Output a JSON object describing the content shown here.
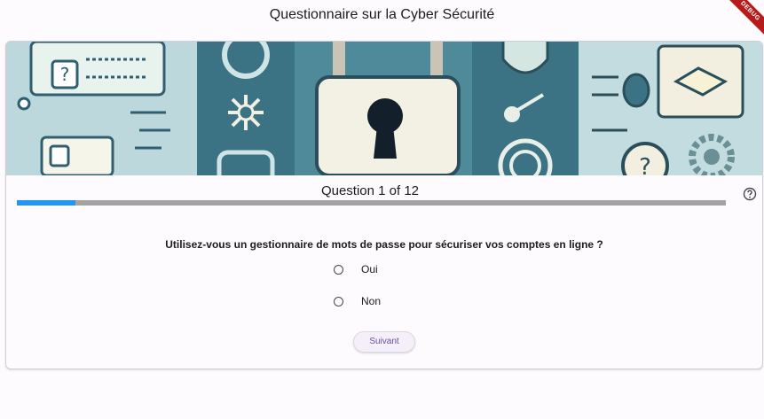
{
  "app": {
    "title": "Questionnaire sur la Cyber Sécurité",
    "debug_label": "DEBUG"
  },
  "quiz": {
    "progress_label": "Question 1 of 12",
    "progress_fraction": 0.083,
    "question": "Utilisez-vous un gestionnaire de mots de passe pour sécuriser vos comptes en ligne ?",
    "options": [
      {
        "label": "Oui",
        "selected": false
      },
      {
        "label": "Non",
        "selected": false
      }
    ],
    "next_label": "Suivant"
  },
  "icons": {
    "help": "help-circle-icon",
    "radio": "radio-unchecked-icon"
  },
  "colors": {
    "progress": "#2196f3",
    "track": "#a3a3a3",
    "accent": "#6b4fa0",
    "banner": "#3b7384"
  }
}
